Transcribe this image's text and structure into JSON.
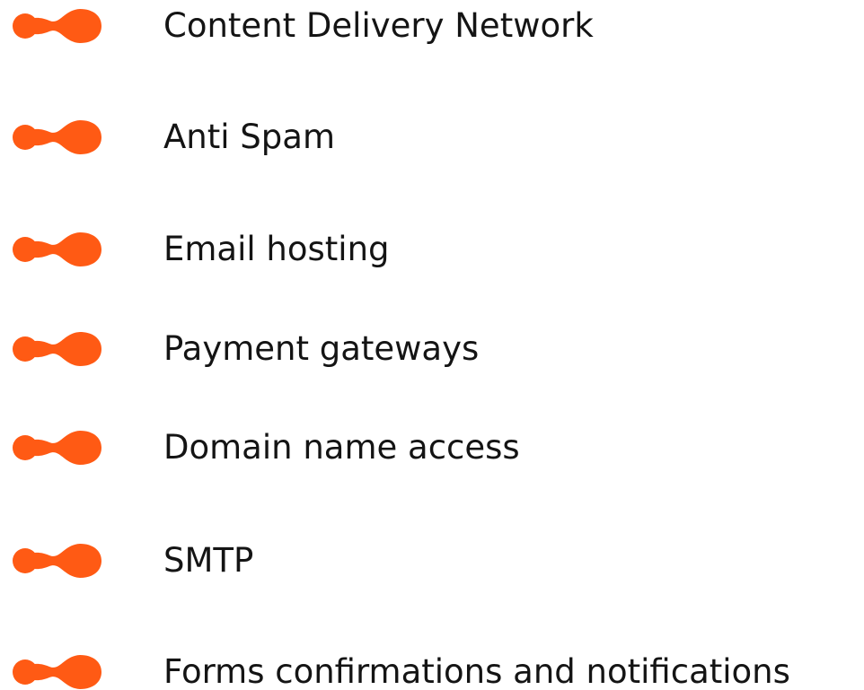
{
  "accent_color": "#ff5a14",
  "items": [
    {
      "label": "Content Delivery Network",
      "icon": "connector-dot-icon"
    },
    {
      "label": "Anti Spam",
      "icon": "connector-dot-icon"
    },
    {
      "label": "Email hosting",
      "icon": "connector-dot-icon"
    },
    {
      "label": "Payment gateways",
      "icon": "connector-dot-icon"
    },
    {
      "label": "Domain name access",
      "icon": "connector-dot-icon"
    },
    {
      "label": "SMTP",
      "icon": "connector-dot-icon"
    },
    {
      "label": "Forms confirmations and notifications",
      "icon": "connector-dot-icon"
    }
  ]
}
